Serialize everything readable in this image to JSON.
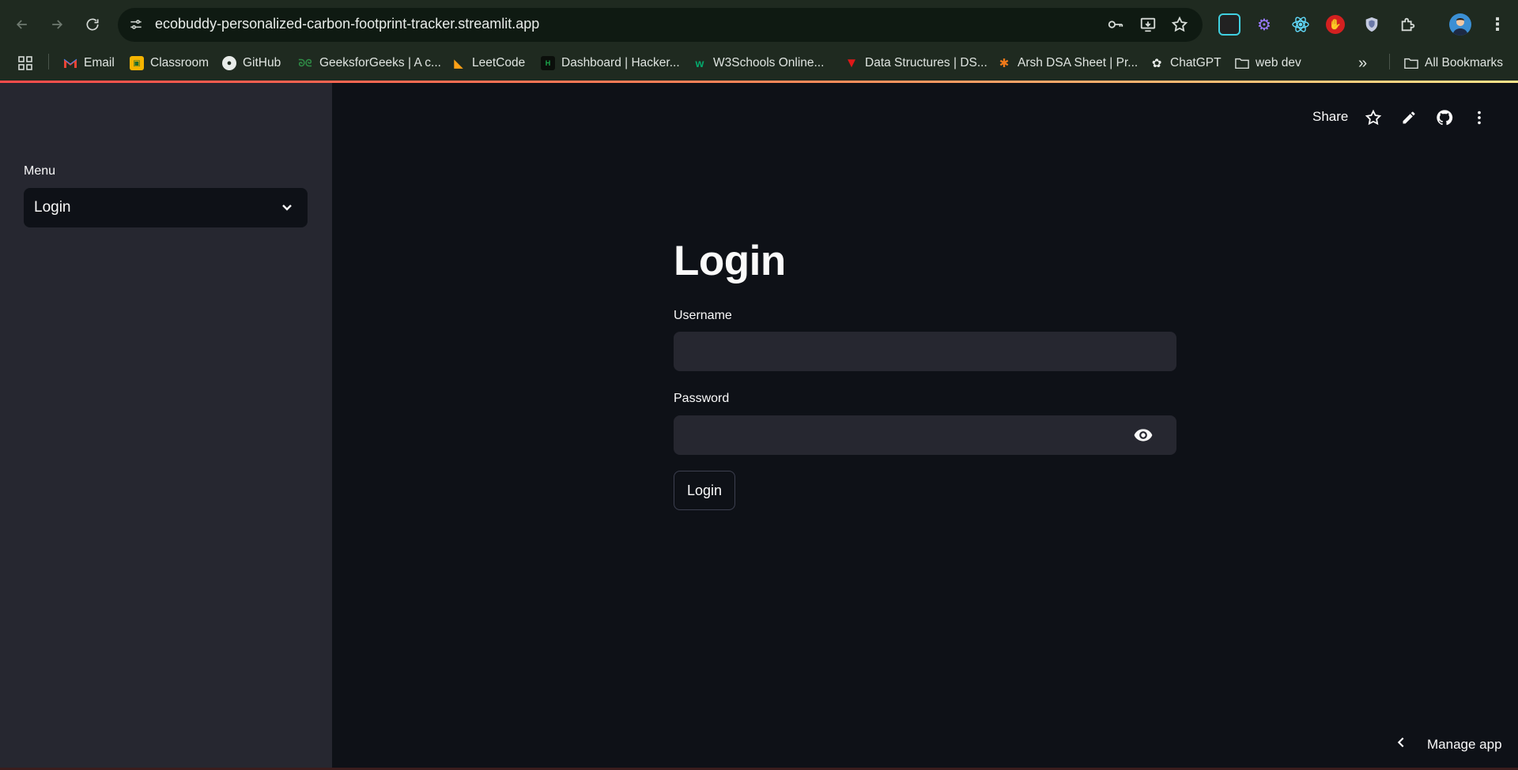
{
  "browser": {
    "url": "ecobuddy-personalized-carbon-footprint-tracker.streamlit.app",
    "bookmarks": [
      {
        "label": "Email",
        "icon": "gmail-icon"
      },
      {
        "label": "Classroom",
        "icon": "classroom-icon"
      },
      {
        "label": "GitHub",
        "icon": "github-icon"
      },
      {
        "label": "GeeksforGeeks | A c...",
        "icon": "geeksforgeeks-icon"
      },
      {
        "label": "LeetCode",
        "icon": "leetcode-icon"
      },
      {
        "label": "Dashboard | Hacker...",
        "icon": "hackerrank-icon"
      },
      {
        "label": "W3Schools Online...",
        "icon": "w3schools-icon"
      },
      {
        "label": "Data Structures | DS...",
        "icon": "tutorial-icon"
      },
      {
        "label": "Arsh DSA Sheet | Pr...",
        "icon": "arsh-icon"
      },
      {
        "label": "ChatGPT",
        "icon": "chatgpt-icon"
      },
      {
        "label": "web dev",
        "icon": "folder-icon"
      }
    ],
    "all_bookmarks": "All Bookmarks",
    "overflow": "»"
  },
  "sidebar": {
    "menu_label": "Menu",
    "menu_value": "Login"
  },
  "header": {
    "share": "Share"
  },
  "form": {
    "title": "Login",
    "username_label": "Username",
    "username_value": "",
    "password_label": "Password",
    "password_value": "",
    "submit_label": "Login"
  },
  "footer": {
    "manage_app": "Manage app"
  },
  "colors": {
    "background": "#0e1117",
    "sidebar": "#262730",
    "input": "#262730",
    "accent_start": "#ff4b4b",
    "accent_end": "#ffe48a"
  }
}
